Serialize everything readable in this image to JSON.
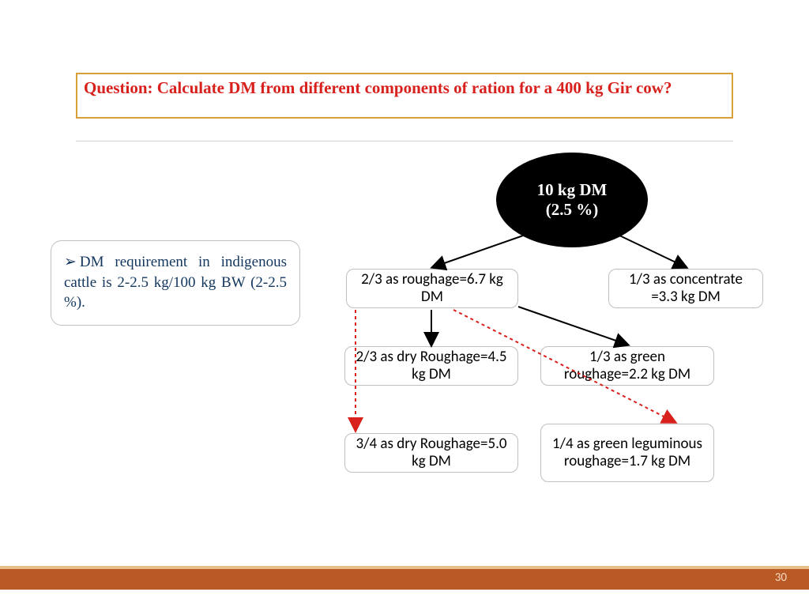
{
  "question": "Question: Calculate DM from different components of ration for a 400 kg Gir cow?",
  "note": "DM requirement in indigenous cattle is 2-2.5 kg/100 kg BW (2-2.5 %).",
  "root": {
    "line1": "10 kg DM",
    "line2": "(2.5 %)"
  },
  "nodes": {
    "roughage": "2/3 as roughage=6.7 kg DM",
    "concentrate": "1/3 as concentrate =3.3 kg DM",
    "dry_roughage": "2/3 as dry Roughage=4.5 kg DM",
    "green_roughage": "1/3 as green roughage=2.2 kg DM",
    "dry_roughage_alt": "3/4 as dry Roughage=5.0 kg DM",
    "green_leguminous": "1/4 as green leguminous roughage=1.7 kg DM"
  },
  "page_number": "30"
}
